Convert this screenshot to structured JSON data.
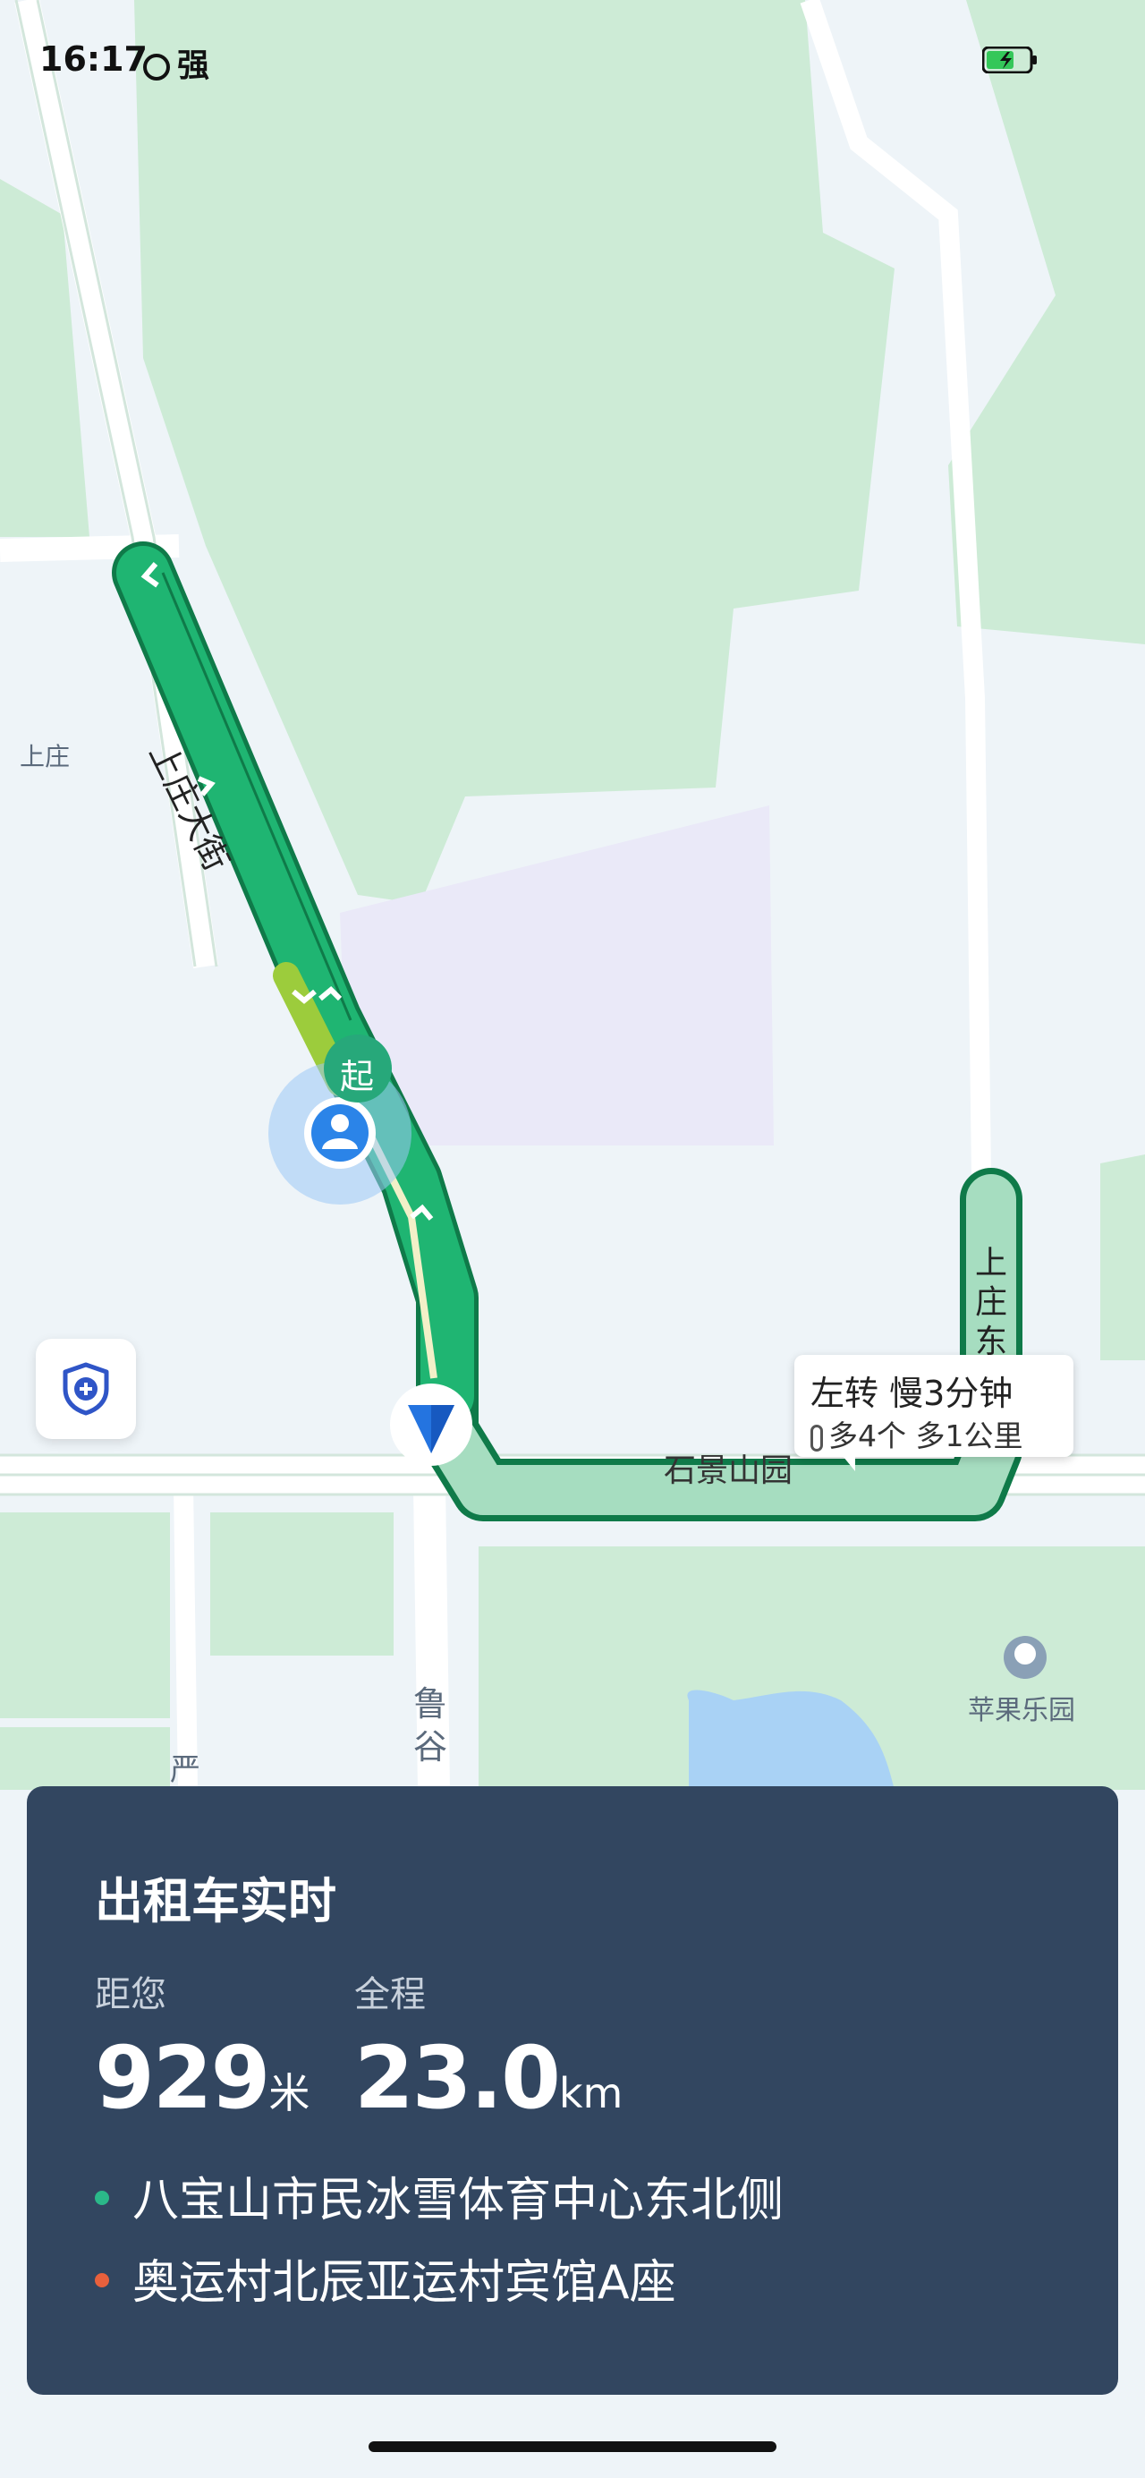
{
  "status_bar": {
    "time": "16:17",
    "carrier": "强"
  },
  "map": {
    "labels": {
      "shangzhuang": "上庄",
      "shangzhuang_street": "上庄大街",
      "shangzhuang_east": "上庄东",
      "shijingshan": "石景山园",
      "lugu": "鲁谷",
      "yan": "严",
      "apple_park": "苹果乐园"
    },
    "start_marker": "起",
    "colors": {
      "route": "#1fb572",
      "water": "#a9d2f5",
      "park": "#cdebd6",
      "road": "#ffffff"
    }
  },
  "callout": {
    "line1": "左转 慢3分钟",
    "line2": "多4个  多1公里"
  },
  "icons": {
    "safety": "shield-plus-icon",
    "me": "user-location-icon",
    "nav": "navigation-arrow-icon"
  },
  "panel": {
    "title": "出租车实时",
    "distance_label": "距您",
    "distance_value": "929",
    "distance_unit": "米",
    "total_label": "全程",
    "total_value": "23.0",
    "total_unit": "km",
    "origin": "八宝山市民冰雪体育中心东北侧",
    "destination": "奥运村北辰亚运村宾馆A座",
    "origin_color": "#2bb889",
    "destination_color": "#e8603c"
  }
}
